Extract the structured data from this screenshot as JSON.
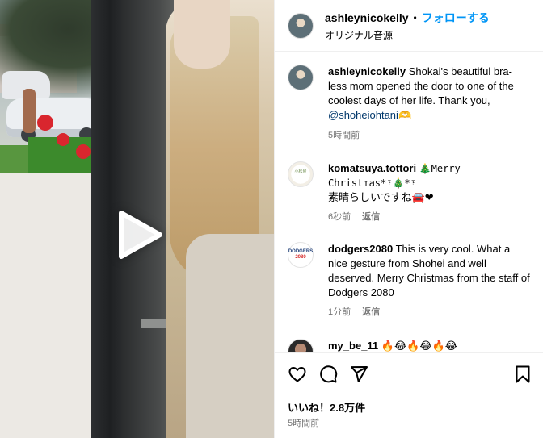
{
  "post": {
    "username": "ashleynicokelly",
    "separator": "•",
    "follow_label": "フォローする",
    "audio_label": "オリジナル音源"
  },
  "video": {
    "play_icon": "play-icon"
  },
  "caption": {
    "username": "ashleynicokelly",
    "text": "Shokai's beautiful bra-less mom opened the door to one of the coolest days of her life. Thank you,",
    "mention": "@shoheiohtani",
    "emoji": "🫶",
    "time": "5時間前"
  },
  "comments": [
    {
      "username": "komatsuya.tottori",
      "line1": "🎄Merry",
      "line2": "Christmas*ᵎ🎄*ᵎ",
      "line3": "素晴らしいですね🚘❤",
      "time": "6秒前",
      "reply": "返信",
      "avatar_label": "小松屋"
    },
    {
      "username": "dodgers2080",
      "text": "This is very cool. What a nice gesture from Shohei and well deserved. Merry Christmas from the staff of Dodgers 2080",
      "time": "1分前",
      "reply": "返信",
      "avatar_label_top": "DODGERS",
      "avatar_label_bottom": "2080"
    },
    {
      "username": "my_be_11",
      "text": "🔥😂🔥😂🔥😂"
    }
  ],
  "actions": {
    "like_icon": "heart-icon",
    "comment_icon": "comment-icon",
    "share_icon": "share-icon",
    "save_icon": "bookmark-icon",
    "likes": "いいね！2.8万件",
    "time": "5時間前"
  },
  "colors": {
    "accent": "#0095f6",
    "muted": "#737373",
    "link": "#00376b"
  }
}
